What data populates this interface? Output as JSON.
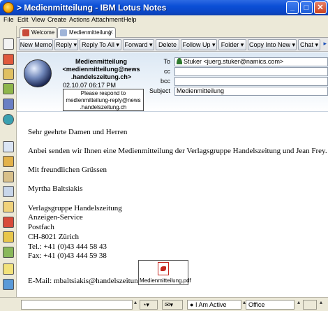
{
  "window": {
    "title": "> Medienmitteilung - IBM Lotus Notes"
  },
  "menu": [
    "File",
    "Edit",
    "View",
    "Create",
    "Actions",
    "Attachment",
    "Help"
  ],
  "tabs": [
    {
      "label": "Welcome",
      "active": false
    },
    {
      "label": "Medienmitteilung",
      "active": true
    }
  ],
  "actions": [
    {
      "label": "New Memo",
      "dropdown": false
    },
    {
      "label": "Reply",
      "dropdown": true
    },
    {
      "label": "Reply To All",
      "dropdown": true
    },
    {
      "label": "Forward",
      "dropdown": true
    },
    {
      "label": "Delete",
      "dropdown": false
    },
    {
      "label": "Follow Up",
      "dropdown": true
    },
    {
      "label": "Folder",
      "dropdown": true
    },
    {
      "label": "Copy Into New",
      "dropdown": true
    },
    {
      "label": "Chat",
      "dropdown": true
    }
  ],
  "header": {
    "sender_lines": [
      "Medienmitteilung",
      "<medienmitteilung@news",
      ".handelszeitung.ch>"
    ],
    "date": "02.10.07 06:17 PM",
    "respond_lines": [
      "Please respond to",
      "medienmitteilung-reply@news",
      ".handelszeitung.ch"
    ],
    "fields": [
      {
        "label": "To",
        "value": "Stuker <juerg.stuker@namics.com>"
      },
      {
        "label": "cc",
        "value": ""
      },
      {
        "label": "bcc",
        "value": ""
      },
      {
        "label": "Subject",
        "value": "Medienmitteilung"
      }
    ]
  },
  "body_lines": [
    "Sehr geehrte Damen und Herren",
    "Anbei senden wir Ihnen eine Medienmitteilung der Verlagsgruppe Handelszeitung und Jean Frey.",
    "Mit freundlichen Grüssen",
    "Myrtha Baltsiakis",
    "Verlagsgruppe Handelszeitung",
    "Anzeigen-Service",
    "Postfach",
    "CH-8021 Zürich",
    "Tel.: +41 (0)43 444 58 43",
    "Fax: +41 (0)43 444 59 38",
    "E-Mail: mbaltsiakis@handelszeitung.ch"
  ],
  "attachment": {
    "name": "Medienmitteilung.pdf",
    "icon": "pdf-icon"
  },
  "status": {
    "presence": "I Am Active",
    "location": "Office"
  },
  "colors": {
    "titlebar": "#0b4fd6",
    "header_bg": "#dce8f4",
    "chrome": "#ece9d8"
  }
}
